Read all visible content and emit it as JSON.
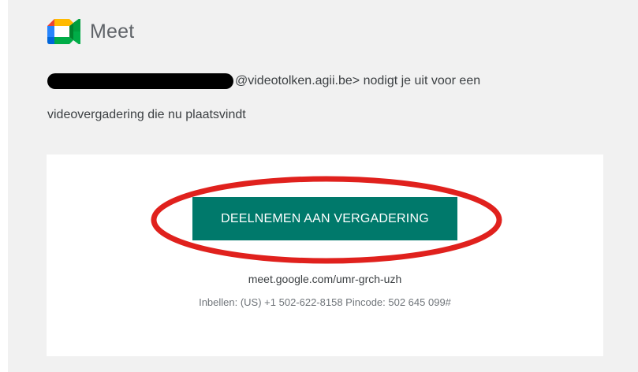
{
  "header": {
    "app_name": "Meet",
    "logo_icon": "google-meet-logo-icon"
  },
  "invite": {
    "sender_suffix": "@videotolken.agii.be> nodigt je uit voor een",
    "line2": "videovergadering die nu plaatsvindt"
  },
  "card": {
    "join_label": "DEELNEMEN AAN VERGADERING",
    "meet_link": "meet.google.com/umr-grch-uzh",
    "dialin": "Inbellen: (US) +1 502-622-8158 Pincode: 502 645 099#"
  },
  "colors": {
    "button": "#00796b",
    "annotation": "#e0211d",
    "background": "#f1f1f1"
  }
}
